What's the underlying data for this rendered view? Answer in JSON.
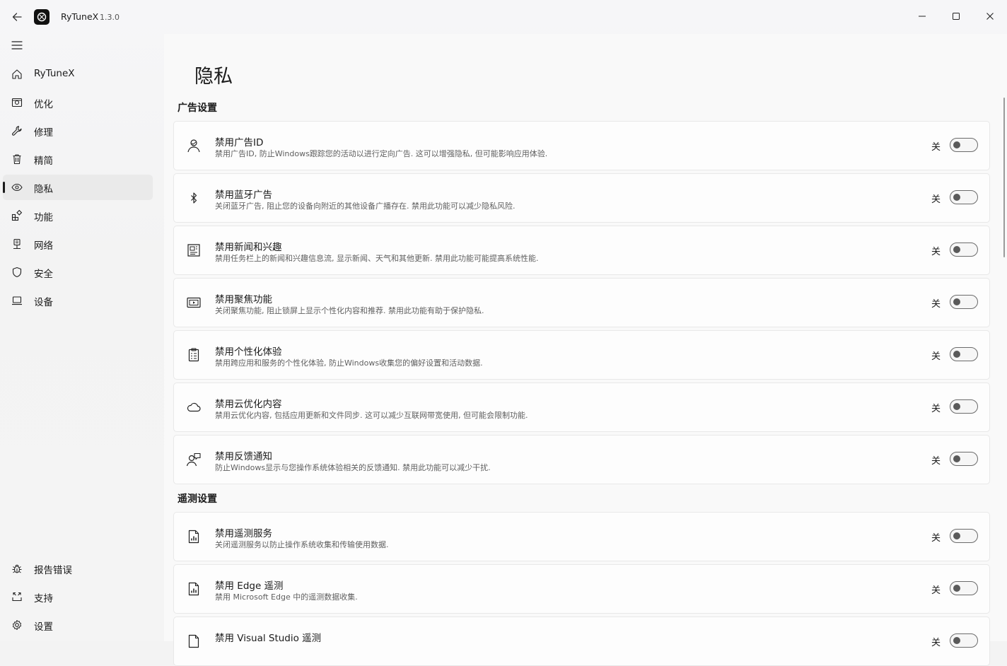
{
  "app": {
    "name": "RyTuneX",
    "version": "1.3.0"
  },
  "nav": {
    "items": [
      {
        "label": "RyTuneX",
        "icon": "home-icon"
      },
      {
        "label": "优化",
        "icon": "optimize-icon"
      },
      {
        "label": "修理",
        "icon": "wrench-icon"
      },
      {
        "label": "精简",
        "icon": "trash-icon"
      },
      {
        "label": "隐私",
        "icon": "eye-icon",
        "active": true
      },
      {
        "label": "功能",
        "icon": "apps-icon"
      },
      {
        "label": "网络",
        "icon": "network-icon"
      },
      {
        "label": "安全",
        "icon": "shield-icon"
      },
      {
        "label": "设备",
        "icon": "laptop-icon"
      }
    ],
    "footer": [
      {
        "label": "报告错误",
        "icon": "bug-icon"
      },
      {
        "label": "支持",
        "icon": "support-icon"
      },
      {
        "label": "设置",
        "icon": "gear-icon"
      }
    ]
  },
  "page": {
    "title": "隐私"
  },
  "sections": [
    {
      "title": "广告设置"
    },
    {
      "title": "遥测设置"
    }
  ],
  "cards": [
    {
      "title": "禁用广告ID",
      "desc": "禁用广告ID, 防止Windows跟踪您的活动以进行定向广告. 这可以增强隐私, 但可能影响应用体验.",
      "state": "关",
      "icon": "person-icon"
    },
    {
      "title": "禁用蓝牙广告",
      "desc": "关闭蓝牙广告, 阻止您的设备向附近的其他设备广播存在. 禁用此功能可以减少隐私风险.",
      "state": "关",
      "icon": "bluetooth-icon"
    },
    {
      "title": "禁用新闻和兴趣",
      "desc": "禁用任务栏上的新闻和兴趣信息流, 显示新闻、天气和其他更新. 禁用此功能可能提高系统性能.",
      "state": "关",
      "icon": "news-icon"
    },
    {
      "title": "禁用聚焦功能",
      "desc": "关闭聚焦功能, 阻止锁屏上显示个性化内容和推荐. 禁用此功能有助于保护隐私.",
      "state": "关",
      "icon": "slideshow-icon"
    },
    {
      "title": "禁用个性化体验",
      "desc": "禁用跨应用和服务的个性化体验, 防止Windows收集您的偏好设置和活动数据.",
      "state": "关",
      "icon": "clipboard-icon"
    },
    {
      "title": "禁用云优化内容",
      "desc": "禁用云优化内容, 包括应用更新和文件同步. 这可以减少互联网带宽使用, 但可能会限制功能.",
      "state": "关",
      "icon": "cloud-icon"
    },
    {
      "title": "禁用反馈通知",
      "desc": "防止Windows显示与您操作系统体验相关的反馈通知. 禁用此功能可以减少干扰.",
      "state": "关",
      "icon": "feedback-icon"
    },
    {
      "title": "禁用遥测服务",
      "desc": "关闭遥测服务以防止操作系统收集和传输使用数据.",
      "state": "关",
      "icon": "report-icon"
    },
    {
      "title": "禁用 Edge 遥测",
      "desc": "禁用 Microsoft Edge 中的遥测数据收集.",
      "state": "关",
      "icon": "report-icon"
    },
    {
      "title": "禁用 Visual Studio 遥测",
      "desc": "",
      "state": "关",
      "icon": "document-icon"
    }
  ]
}
